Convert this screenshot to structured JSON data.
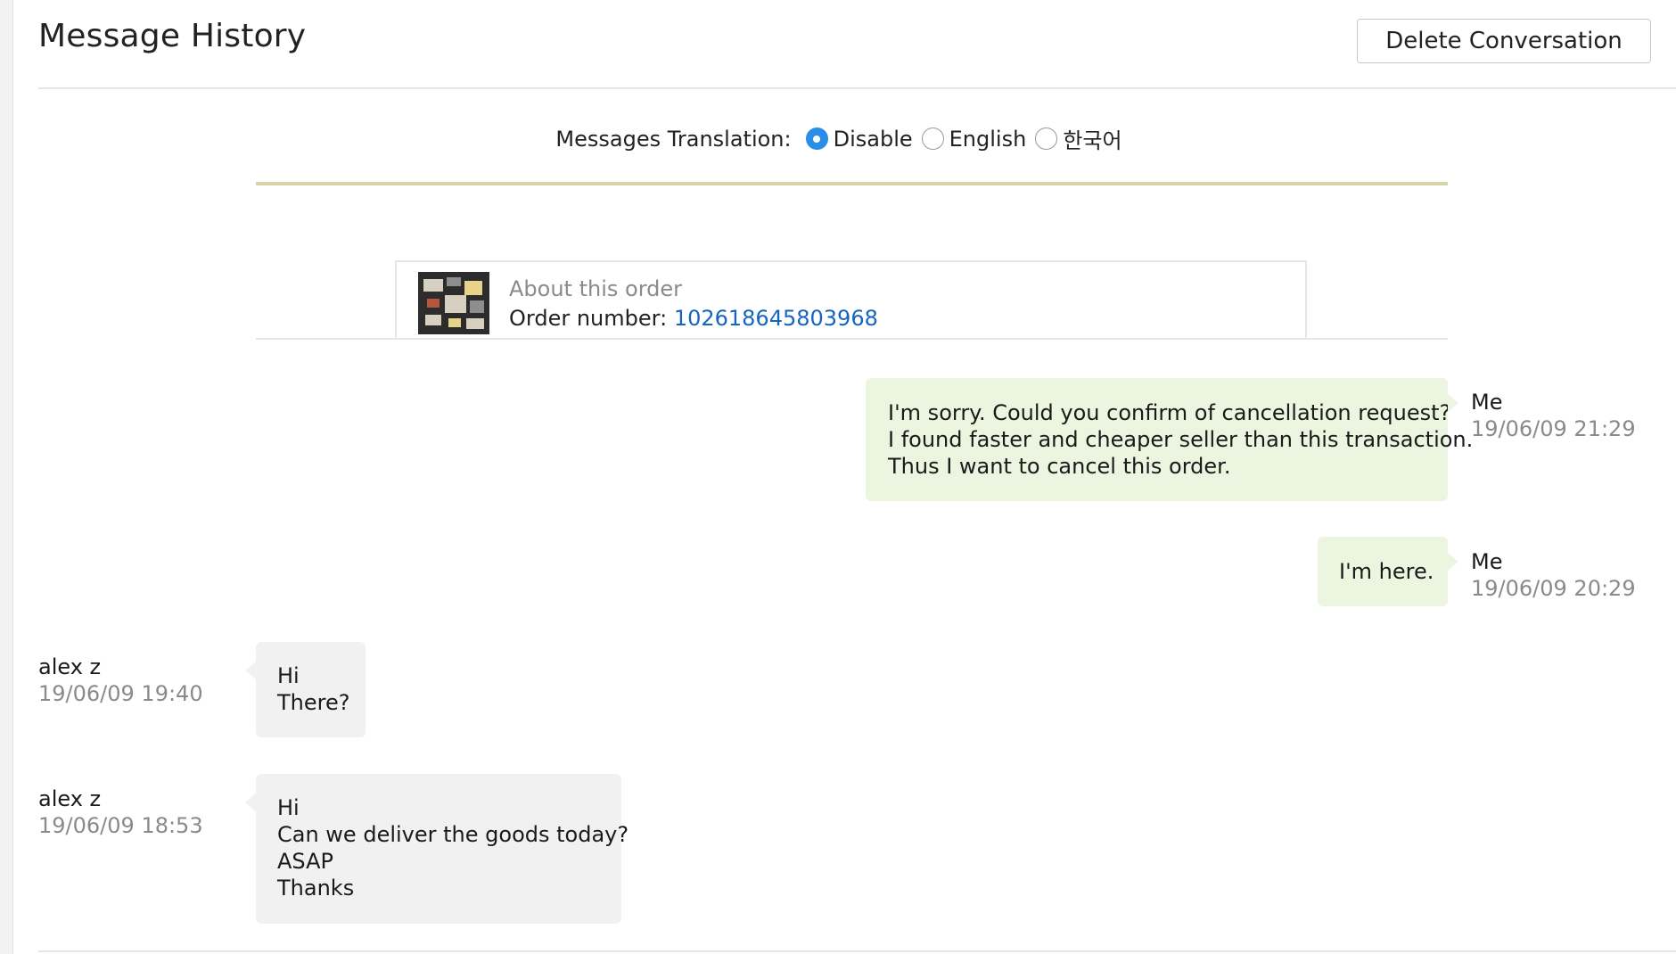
{
  "header": {
    "title": "Message History",
    "delete_label": "Delete Conversation"
  },
  "translation": {
    "label": "Messages Translation:",
    "options": [
      {
        "label": "Disable",
        "selected": true
      },
      {
        "label": "English",
        "selected": false
      },
      {
        "label": "한국어",
        "selected": false
      }
    ]
  },
  "order": {
    "heading": "About this order",
    "number_label": "Order number:",
    "number": "102618645803968"
  },
  "messages": [
    {
      "sender": "Me",
      "time": "19/06/09 21:29",
      "lines": [
        "I'm sorry. Could you confirm of cancellation request?",
        "I found faster and cheaper seller than this transaction.",
        "Thus I want to cancel this order."
      ]
    },
    {
      "sender": "Me",
      "time": "19/06/09 20:29",
      "lines": [
        "I'm here."
      ]
    },
    {
      "sender": "alex z",
      "time": "19/06/09 19:40",
      "lines": [
        "Hi",
        "There?"
      ]
    },
    {
      "sender": "alex z",
      "time": "19/06/09 18:53",
      "lines": [
        "Hi",
        "Can we deliver the goods today?",
        "ASAP",
        "Thanks"
      ]
    }
  ],
  "colors": {
    "accent_blue": "#2a8de8",
    "link_blue": "#1565c0",
    "my_bubble": "#ecf5df",
    "their_bubble": "#f1f1f1",
    "divider_olive": "#d8d6a8"
  },
  "icons": {
    "order_thumbnail": "product-image",
    "radio": "radio-button"
  }
}
